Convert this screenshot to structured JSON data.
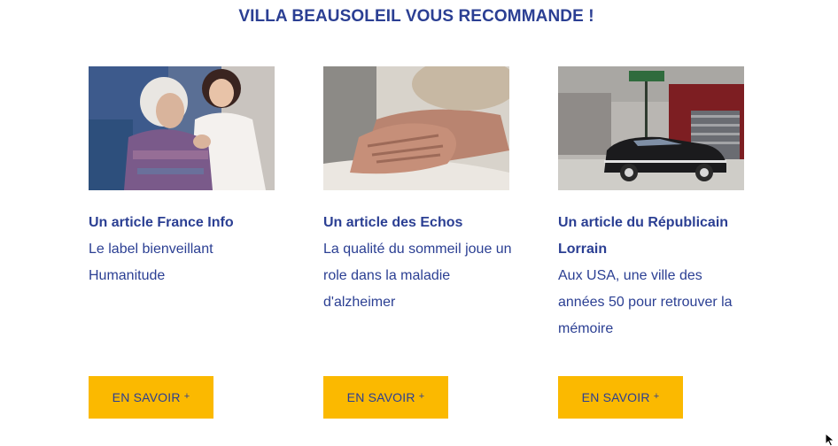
{
  "section": {
    "title": "VILLA BEAUSOLEIL VOUS RECOMMANDE !"
  },
  "colors": {
    "heading": "#2b3f93",
    "button_bg": "#fbb900",
    "button_text": "#2b3f93"
  },
  "cards": [
    {
      "title": "Un article France Info",
      "text": "Le label bienveillant Humanitude",
      "button_label": "EN SAVOIR",
      "button_suffix": "+",
      "image": "photo-elderly-woman-with-caregiver"
    },
    {
      "title": "Un article des Echos",
      "text": "La qualité du sommeil joue un role dans la maladie d'alzheimer",
      "button_label": "EN SAVOIR",
      "button_suffix": "+",
      "image": "photo-elderly-hands-on-bed"
    },
    {
      "title": "Un article du Républicain Lorrain",
      "text": "Aux USA, une ville des années 50 pour retrouver la mémoire",
      "button_label": "EN SAVOIR",
      "button_suffix": "+",
      "image": "photo-vintage-car-street"
    }
  ]
}
